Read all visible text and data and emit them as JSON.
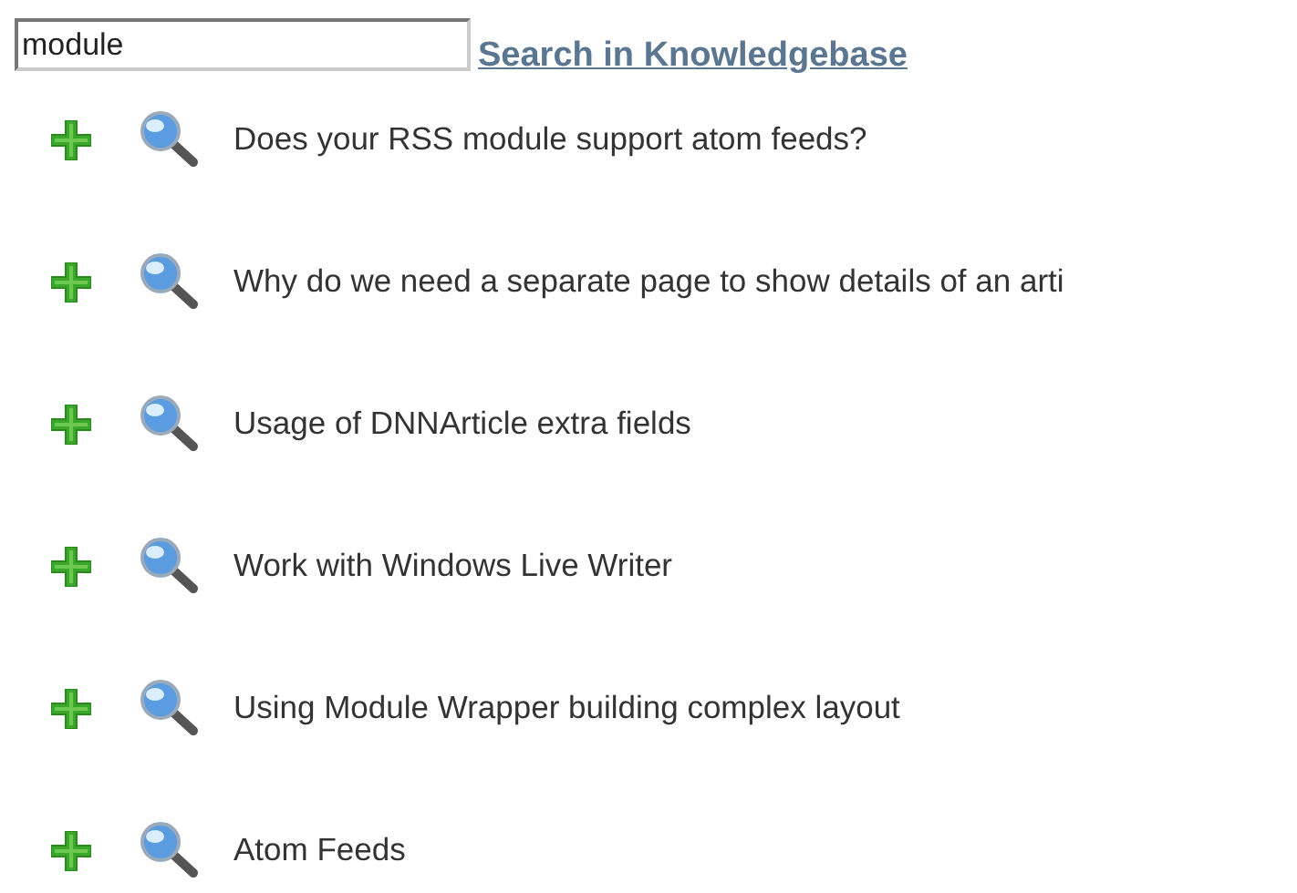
{
  "search": {
    "value": "module",
    "link": "Search in Knowledgebase"
  },
  "articles": [
    {
      "title": "Does your RSS module support atom feeds?"
    },
    {
      "title": "Why do we need a separate page to show details of an arti"
    },
    {
      "title": "Usage of DNNArticle extra fields"
    },
    {
      "title": "Work with Windows Live Writer"
    },
    {
      "title": "Using Module Wrapper building complex layout"
    },
    {
      "title": "Atom Feeds"
    }
  ]
}
